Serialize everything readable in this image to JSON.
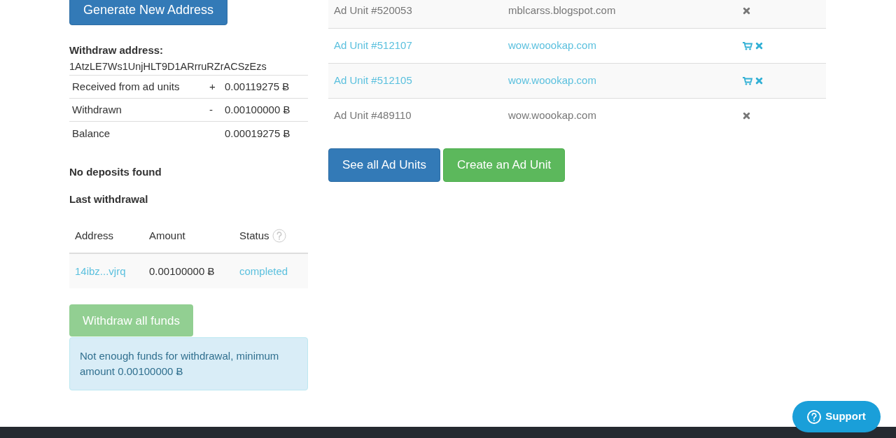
{
  "generate_button": "Generate New Address",
  "withdraw_address": {
    "label": "Withdraw address:",
    "value": "1AtzLE7Ws1UnjHLT9D1ARrruRZrACSzEzs"
  },
  "balance_rows": [
    {
      "label": "Received from ad units",
      "sign": "+",
      "amount": "0.00119275 Ƀ"
    },
    {
      "label": "Withdrawn",
      "sign": "-",
      "amount": "0.00100000 Ƀ"
    },
    {
      "label": "Balance",
      "amount": "0.00019275 Ƀ"
    }
  ],
  "deposits_note": "No deposits found",
  "last_withdrawal": {
    "title": "Last withdrawal",
    "columns": [
      "Address",
      "Amount",
      "Status"
    ],
    "rows": [
      {
        "address": "14ibz...vjrq",
        "amount": "0.00100000 Ƀ",
        "status": "completed"
      }
    ]
  },
  "withdraw_button": {
    "label": "Withdraw all funds",
    "disabled": true
  },
  "withdraw_alert": "Not enough funds for withdrawal, minimum amount 0.00100000 Ƀ",
  "ad_units": [
    {
      "name": "Ad Unit #520053",
      "site": "mblcarss.blogspot.com",
      "active": false
    },
    {
      "name": "Ad Unit #512107",
      "site": "wow.woookap.com",
      "active": true
    },
    {
      "name": "Ad Unit #512105",
      "site": "wow.woookap.com",
      "active": true
    },
    {
      "name": "Ad Unit #489110",
      "site": "wow.woookap.com",
      "active": false
    }
  ],
  "ad_buttons": [
    {
      "label": "See all Ad Units",
      "kind": "primary"
    },
    {
      "label": "Create an Ad Unit",
      "kind": "success"
    }
  ],
  "support_button": "Support"
}
